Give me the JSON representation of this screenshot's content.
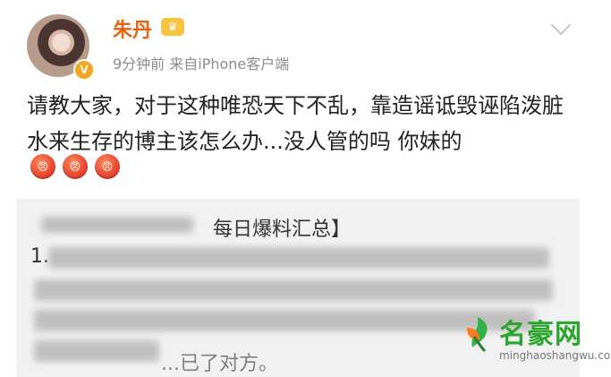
{
  "user": {
    "name": "朱丹",
    "meta": "9分钟前  来自iPhone客户端"
  },
  "post": {
    "text": "请教大家，对于这种唯恐天下不乱，靠造谣诋毁诬陷泼脏水来生存的博主该怎么办...没人管的吗 你妹的"
  },
  "emojis": [
    "angry",
    "angry",
    "angry"
  ],
  "repost": {
    "title": "每日爆料汇总】",
    "number": "1.",
    "tail_text": "...已了对方。"
  },
  "watermark": {
    "brand": "名豪网",
    "url": "minghaoshangwu.com"
  },
  "colors": {
    "name": "#e8620c",
    "watermark": "#2aa52d",
    "repost_bg": "#f1f1f1"
  }
}
